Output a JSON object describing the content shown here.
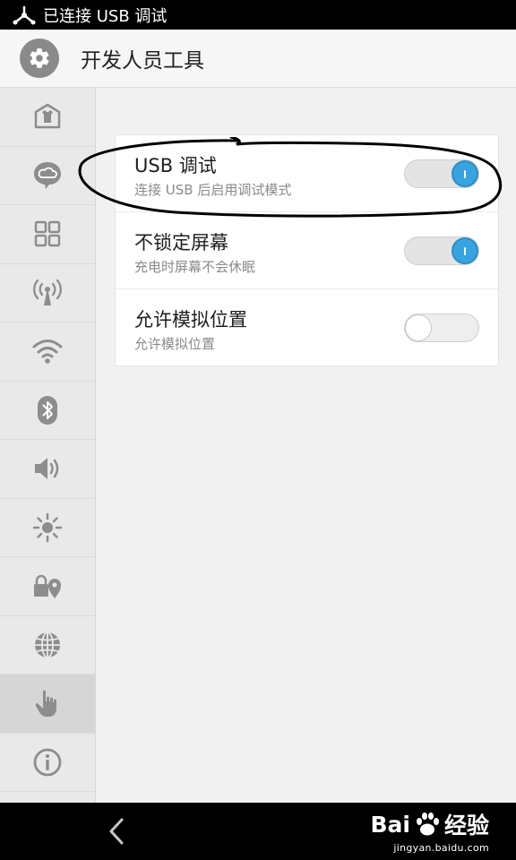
{
  "status_bar": {
    "text": "已连接 USB 调试",
    "icon": "usb-icon"
  },
  "header": {
    "title": "开发人员工具",
    "icon": "gear-icon"
  },
  "sidebar": {
    "items": [
      {
        "icon": "theme-shirt-icon"
      },
      {
        "icon": "cloud-bubble-icon"
      },
      {
        "icon": "apps-grid-icon"
      },
      {
        "icon": "antenna-signal-icon"
      },
      {
        "icon": "wifi-icon"
      },
      {
        "icon": "bluetooth-icon"
      },
      {
        "icon": "volume-icon"
      },
      {
        "icon": "brightness-icon"
      },
      {
        "icon": "lock-location-icon"
      },
      {
        "icon": "globe-icon"
      },
      {
        "icon": "hand-touch-icon",
        "active": true
      },
      {
        "icon": "info-icon"
      }
    ]
  },
  "settings": [
    {
      "label": "USB 调试",
      "description": "连接 USB 后启用调试模式",
      "enabled": true
    },
    {
      "label": "不锁定屏幕",
      "description": "充电时屏幕不会休眠",
      "enabled": true
    },
    {
      "label": "允许模拟位置",
      "description": "允许模拟位置",
      "enabled": false
    }
  ],
  "watermark": {
    "brand": "Bai",
    "brand2": "经验",
    "site": "jingyan.baidu.com"
  },
  "colors": {
    "accent": "#37a3df",
    "status_bar": "#000000",
    "sidebar_bg": "#e9e9e9"
  }
}
